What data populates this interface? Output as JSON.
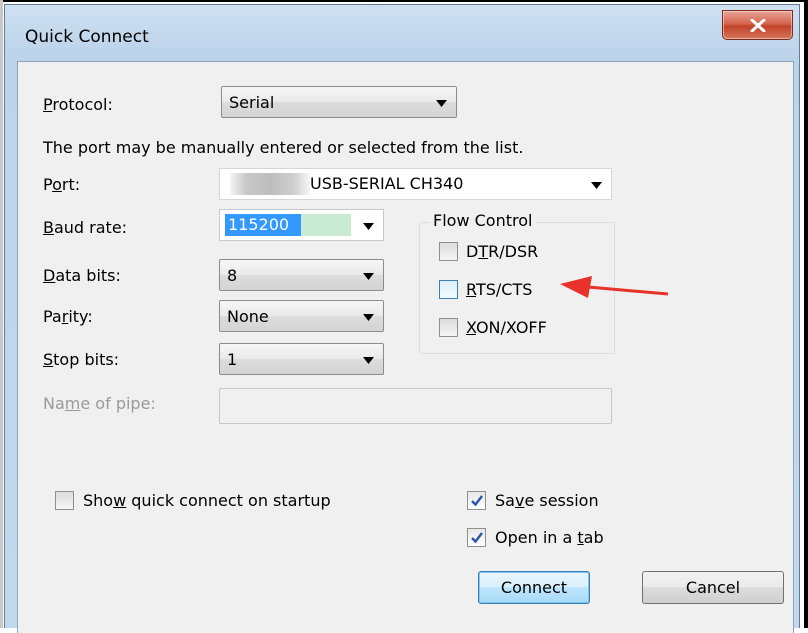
{
  "window": {
    "title": "Quick Connect",
    "close_glyph": "X"
  },
  "form": {
    "protocol_label": "Protocol:",
    "protocol_value": "Serial",
    "hint": "The port may be manually entered or selected from the list.",
    "port_label": "Port:",
    "port_value": "USB-SERIAL CH340",
    "baud_label": "Baud rate:",
    "baud_value": "115200",
    "databits_label": "Data bits:",
    "databits_value": "8",
    "parity_label": "Parity:",
    "parity_value": "None",
    "stopbits_label": "Stop bits:",
    "stopbits_value": "1",
    "pipe_label": "Name of pipe:",
    "pipe_value": ""
  },
  "flow_control": {
    "title": "Flow Control",
    "items": [
      {
        "label": "DTR/DSR",
        "checked": false
      },
      {
        "label": "RTS/CTS",
        "checked": false
      },
      {
        "label": "XON/XOFF",
        "checked": false
      }
    ]
  },
  "options": {
    "show_on_startup": {
      "label": "Show quick connect on startup",
      "checked": false
    },
    "save_session": {
      "label": "Save session",
      "checked": true
    },
    "open_in_tab": {
      "label": "Open in a tab",
      "checked": true
    }
  },
  "buttons": {
    "connect": "Connect",
    "cancel": "Cancel"
  },
  "colors": {
    "selection": "#3399ff",
    "annotation_arrow": "#e8322a",
    "close_button": "#c8472e"
  }
}
